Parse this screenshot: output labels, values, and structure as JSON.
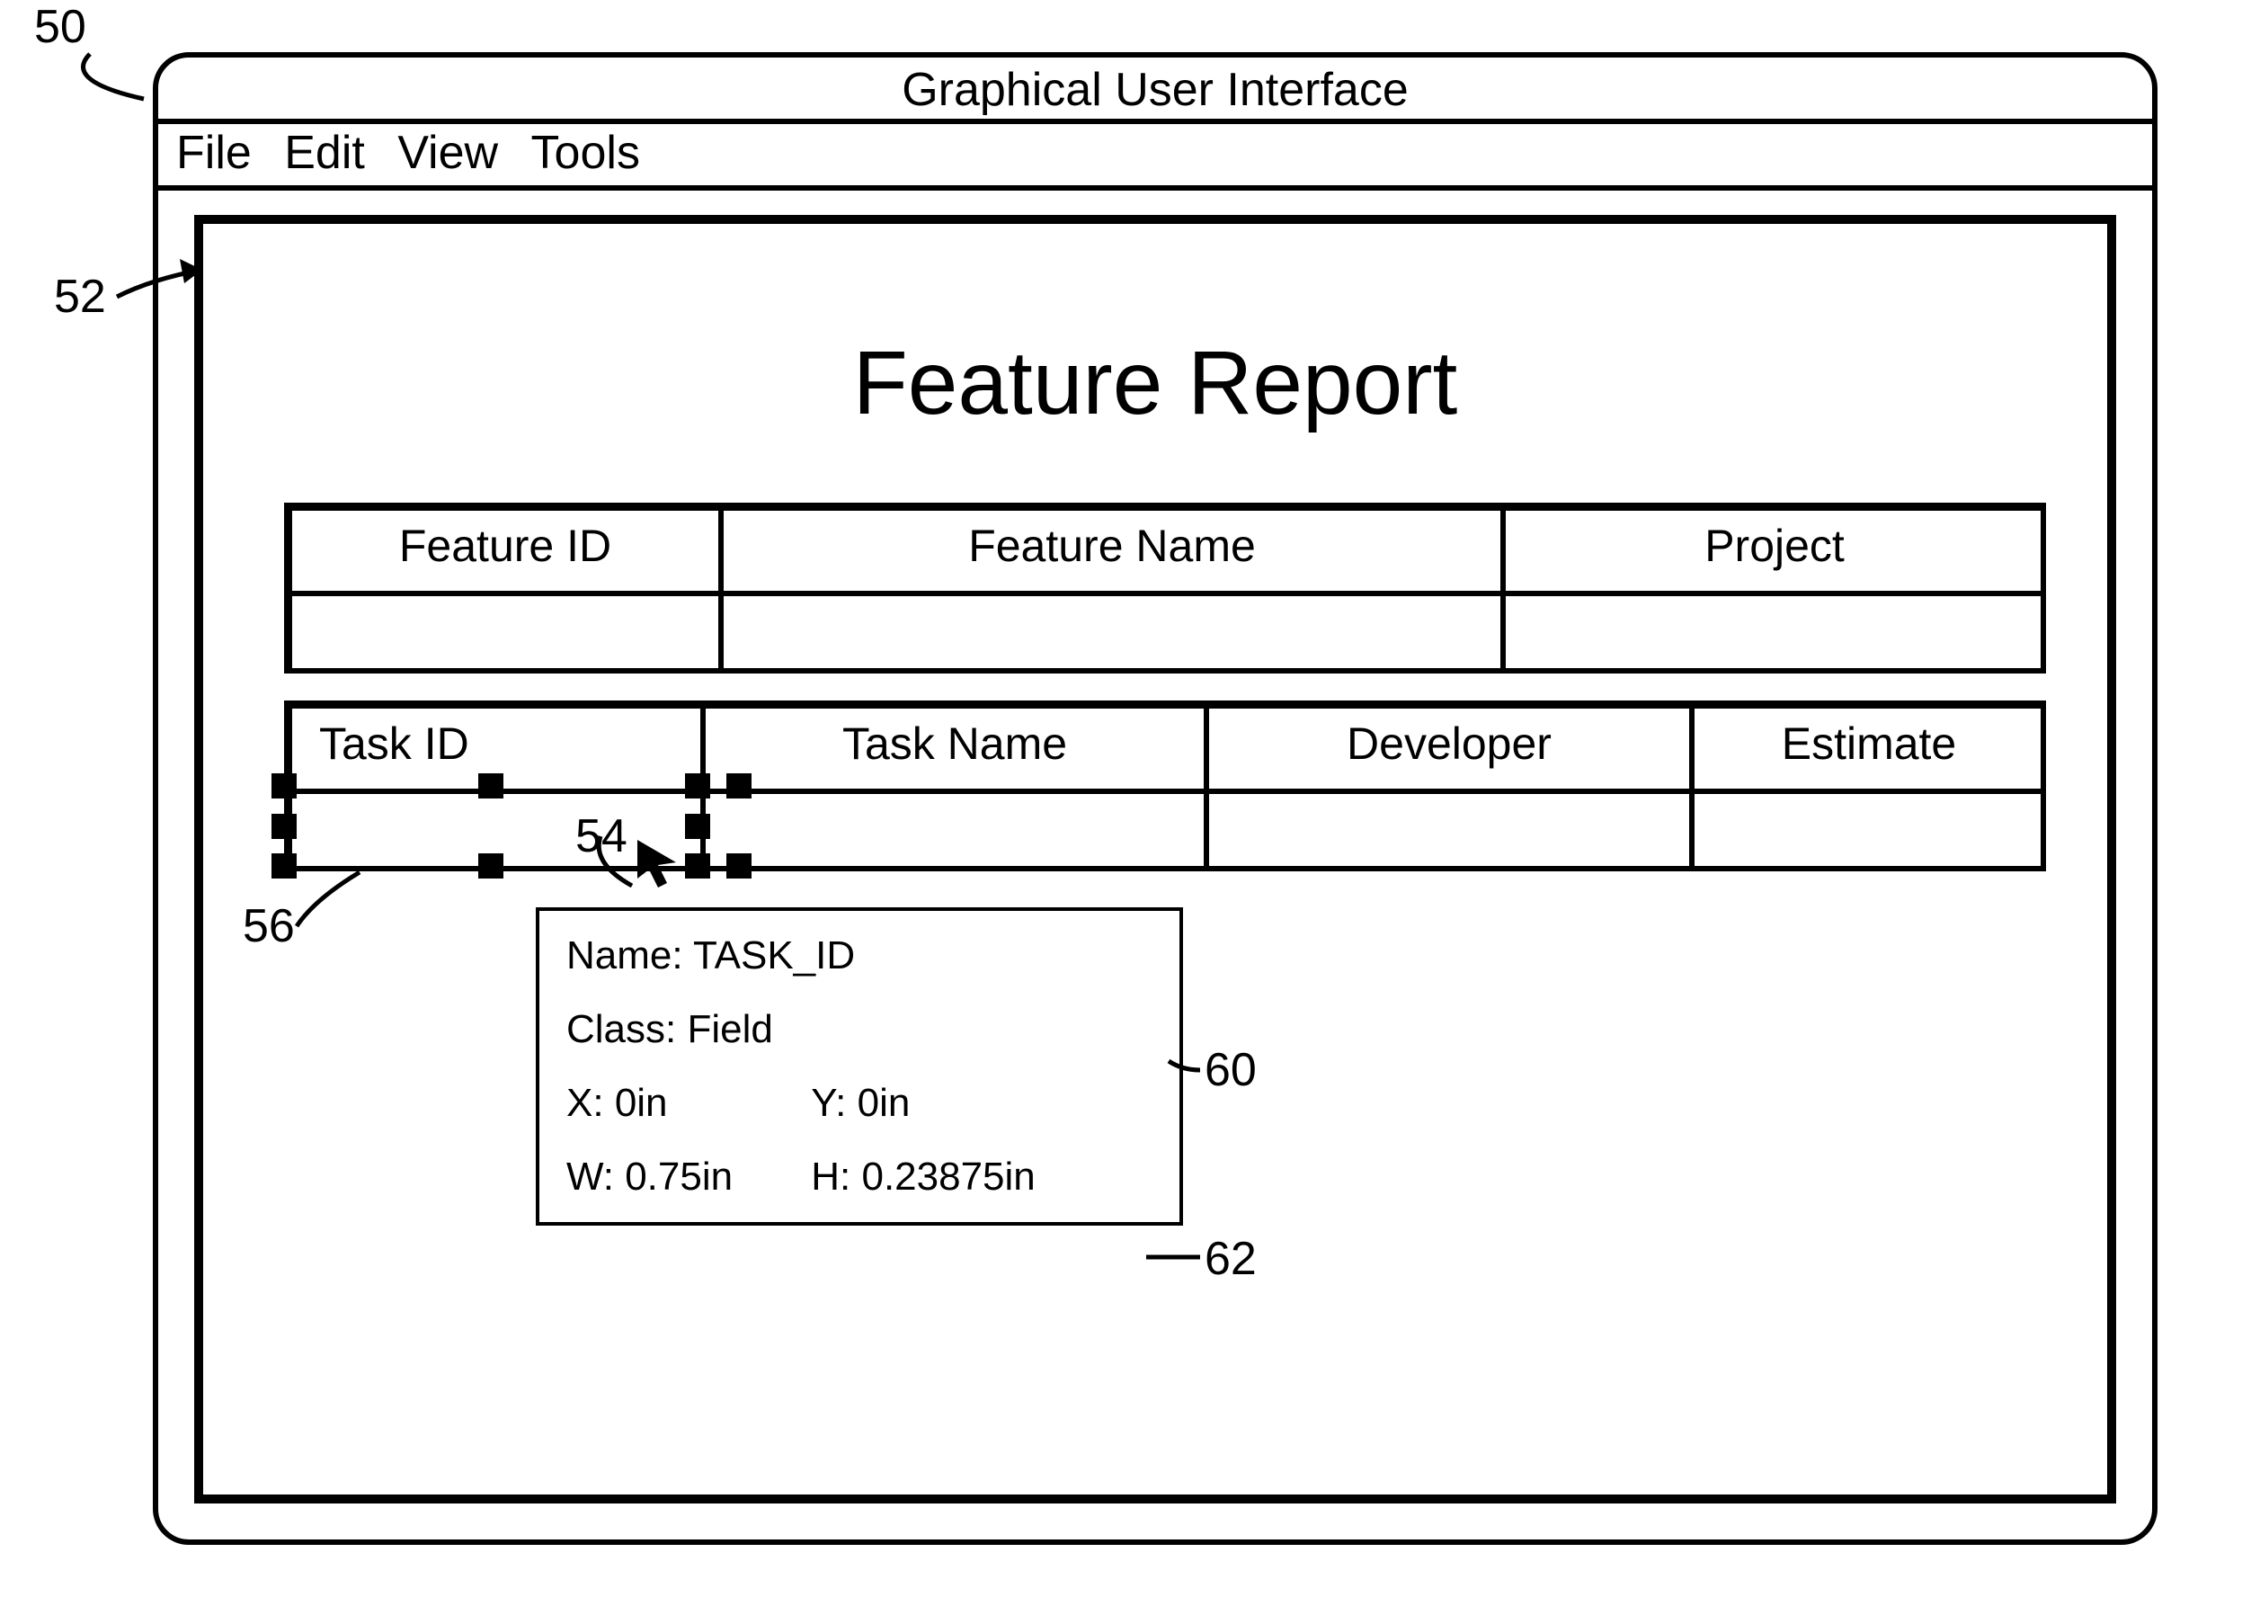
{
  "window": {
    "title": "Graphical User Interface",
    "menu": {
      "file": "File",
      "edit": "Edit",
      "view": "View",
      "tools": "Tools"
    }
  },
  "report": {
    "title": "Feature Report",
    "table1": {
      "headers": {
        "feature_id": "Feature ID",
        "feature_name": "Feature Name",
        "project": "Project"
      }
    },
    "table2": {
      "headers": {
        "task_id": "Task ID",
        "task_name": "Task Name",
        "developer": "Developer",
        "estimate": "Estimate"
      }
    }
  },
  "infobox": {
    "name_label": "Name:",
    "name_value": "TASK_ID",
    "class_label": "Class:",
    "class_value": "Field",
    "x_label": "X:",
    "x_value": "0in",
    "y_label": "Y:",
    "y_value": "0in",
    "w_label": "W:",
    "w_value": "0.75in",
    "h_label": "H:",
    "h_value": "0.23875in"
  },
  "callouts": {
    "n50": "50",
    "n52": "52",
    "n54": "54",
    "n56": "56",
    "n60": "60",
    "n62": "62"
  }
}
